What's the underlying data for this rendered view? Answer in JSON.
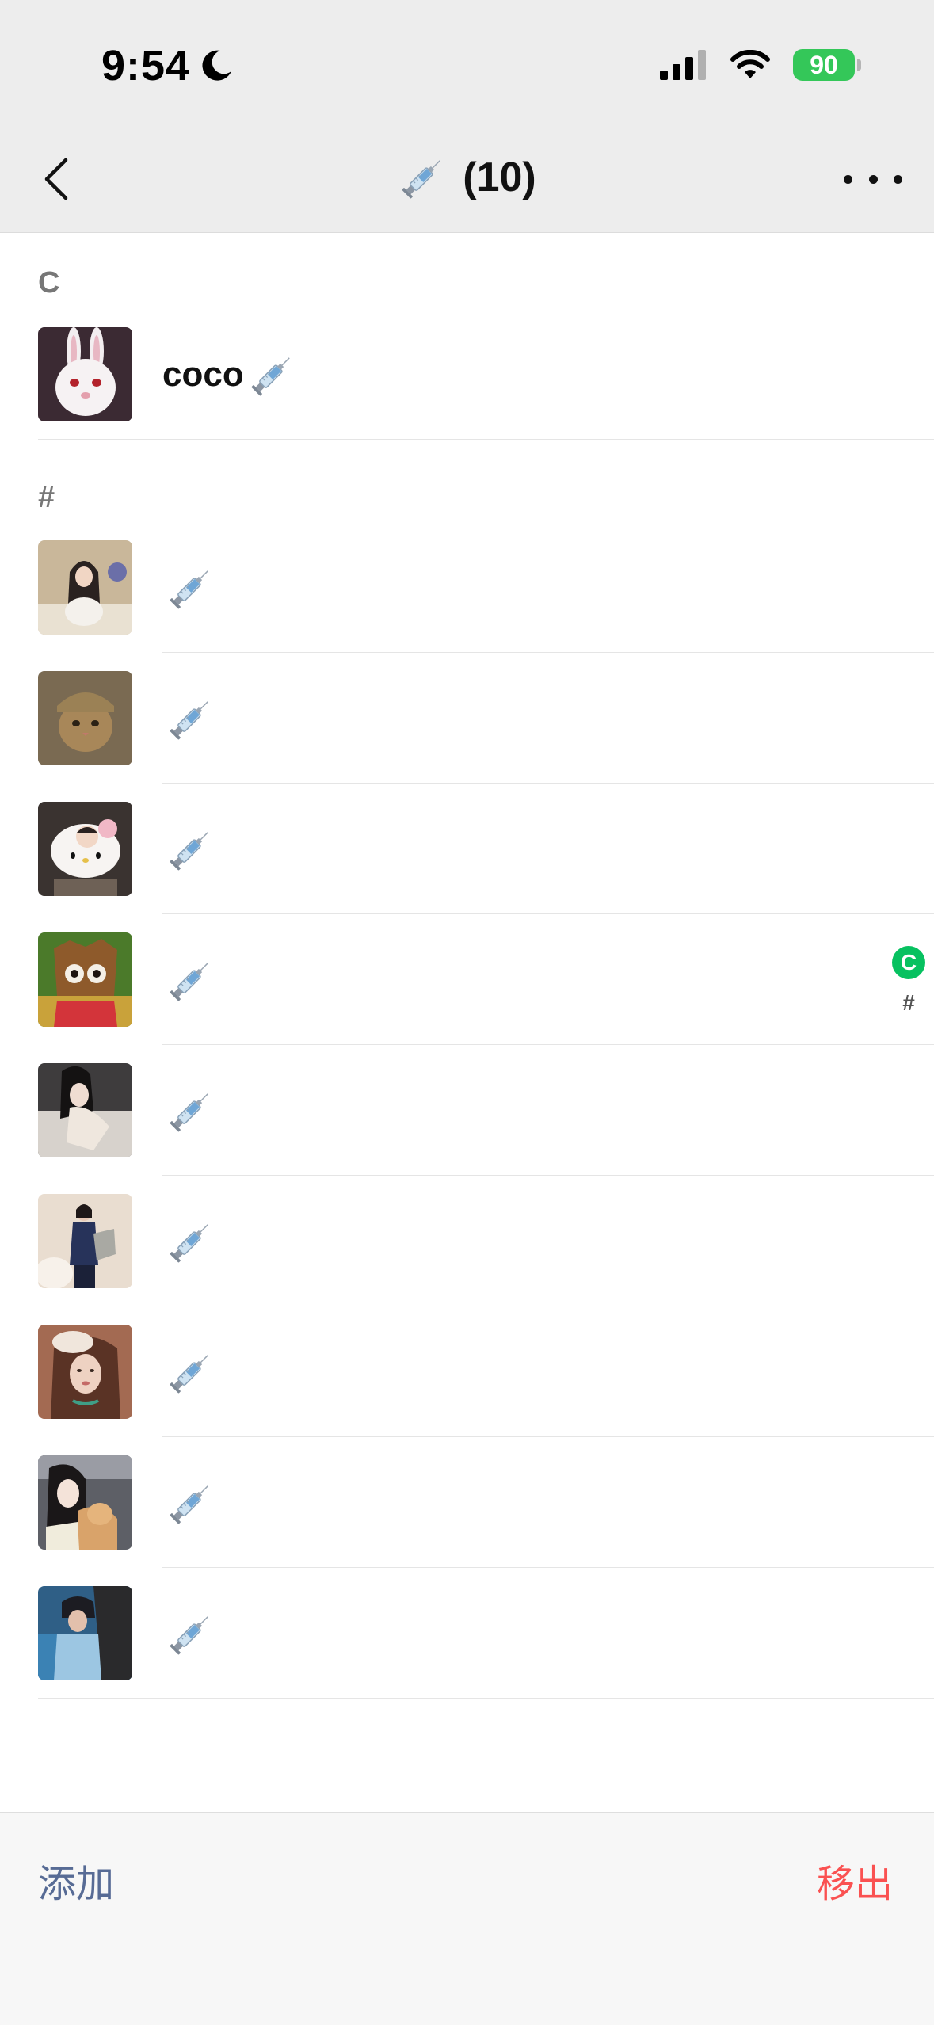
{
  "status_bar": {
    "time": "9:54",
    "battery": "90"
  },
  "nav": {
    "title_count": "(10)"
  },
  "sections": {
    "c_header": "C",
    "hash_header": "#"
  },
  "members": [
    {
      "name": "coco"
    },
    {
      "name": ""
    },
    {
      "name": ""
    },
    {
      "name": ""
    },
    {
      "name": ""
    },
    {
      "name": ""
    },
    {
      "name": ""
    },
    {
      "name": ""
    },
    {
      "name": ""
    },
    {
      "name": ""
    }
  ],
  "index_bar": {
    "c": "C",
    "hash": "#"
  },
  "bottom": {
    "add_label": "添加",
    "remove_label": "移出"
  },
  "colors": {
    "accent_green": "#07c160",
    "link_blue": "#576b95",
    "danger_red": "#fa5151"
  },
  "icons": {
    "name_emoji": "syringe-icon"
  }
}
